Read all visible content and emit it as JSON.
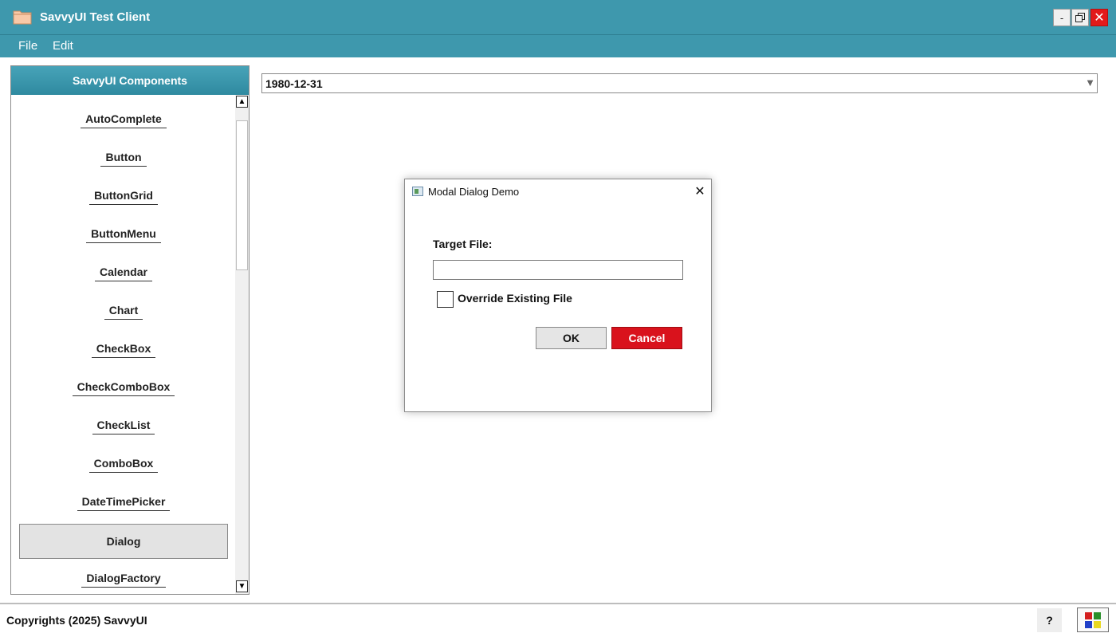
{
  "window": {
    "title": "SavvyUI Test Client",
    "min_label": "-",
    "close_label": "✕",
    "icon": "folder-icon",
    "accent_color": "#3e98ad"
  },
  "menu": {
    "file": "File",
    "edit": "Edit"
  },
  "sidebar": {
    "header": "SavvyUI Components",
    "items": [
      {
        "label": "AutoComplete"
      },
      {
        "label": "Button"
      },
      {
        "label": "ButtonGrid"
      },
      {
        "label": "ButtonMenu"
      },
      {
        "label": "Calendar"
      },
      {
        "label": "Chart"
      },
      {
        "label": "CheckBox"
      },
      {
        "label": "CheckComboBox"
      },
      {
        "label": "CheckList"
      },
      {
        "label": "ComboBox"
      },
      {
        "label": "DateTimePicker"
      },
      {
        "label": "Dialog",
        "selected": true
      },
      {
        "label": "DialogFactory"
      }
    ],
    "scroll_up": "▲",
    "scroll_down": "▼"
  },
  "date_picker": {
    "value": "1980-12-31",
    "arrow": "▼"
  },
  "dialog": {
    "title": "Modal Dialog Demo",
    "close": "✕",
    "target_label": "Target File:",
    "target_value": "",
    "override_label": "Override Existing File",
    "override_checked": false,
    "ok": "OK",
    "cancel": "Cancel",
    "cancel_color": "#d9121c"
  },
  "footer": {
    "copyright": "Copyrights (2025) SavvyUI",
    "help": "?"
  }
}
